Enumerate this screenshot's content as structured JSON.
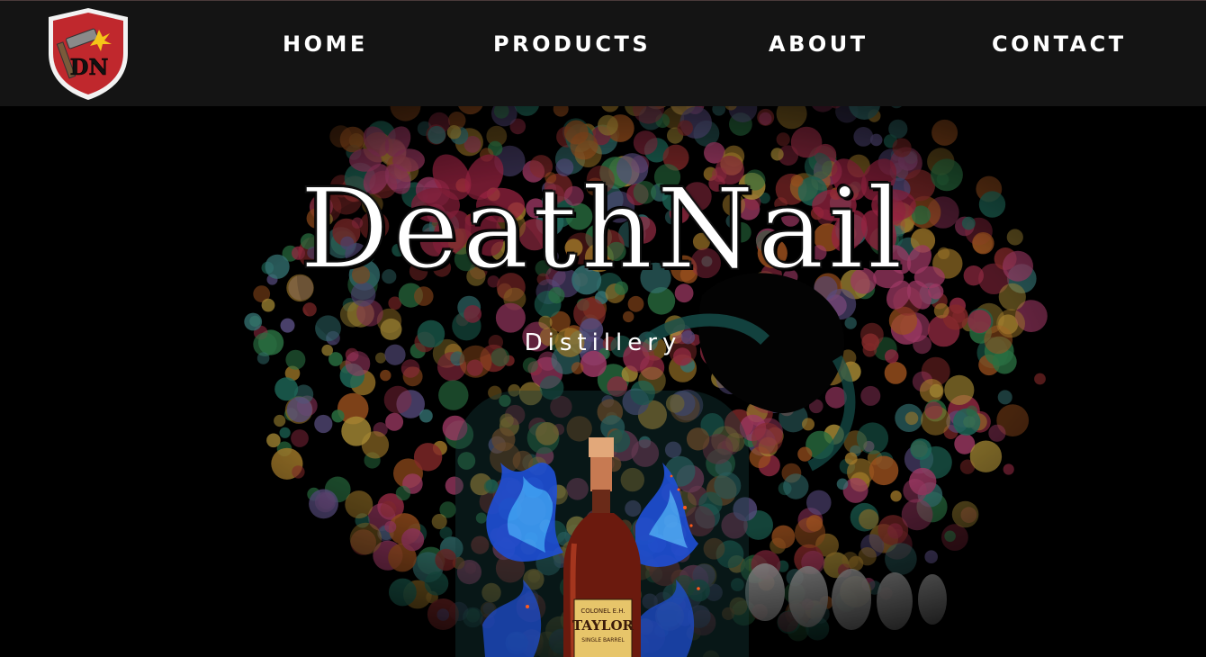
{
  "nav": {
    "logo_text": "DN",
    "home_label": "HOME",
    "products_label": "PRODUCTS",
    "about_label": "ABOUT",
    "contact_label": "CONTACT"
  },
  "hero": {
    "title": "DeathNail",
    "subtitle": "Distillery",
    "product_label_line1": "COLONEL E.H.",
    "product_label_line2": "TAYLOR",
    "product_label_line3": "SINGLE BARREL"
  },
  "colors": {
    "navbar_bg": "#141414",
    "logo_shield": "#c0282d",
    "text": "#ffffff"
  }
}
